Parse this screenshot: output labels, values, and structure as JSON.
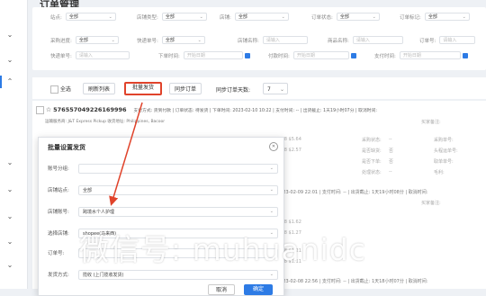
{
  "page_title": "订单管理",
  "colors": {
    "accent": "#2d7be5",
    "highlight": "#e0432b"
  },
  "filters": {
    "row1": [
      {
        "label": "站点:",
        "value": "全部"
      },
      {
        "label": "店铺类型:",
        "value": "全部"
      },
      {
        "label": "店铺:",
        "value": "全部"
      },
      {
        "label": "订单状态:",
        "value": "全部"
      },
      {
        "label": "订单标记:",
        "value": "全部"
      }
    ],
    "row2": [
      {
        "label": "采购进度:",
        "value": "全部"
      },
      {
        "label": "快递单号:",
        "value": "全部"
      },
      {
        "label": "店铺名称:",
        "placeholder": "请输入"
      },
      {
        "label": "商品名称:",
        "placeholder": "请输入"
      },
      {
        "label": "订单号:",
        "placeholder": "请输入"
      }
    ],
    "row3": [
      {
        "label": "快递单号:",
        "placeholder": "请输入"
      },
      {
        "label": "下单时间:",
        "placeholder": "开始日期"
      },
      {
        "label": "付款时间:",
        "placeholder": "开始日期"
      },
      {
        "label": "支付时间:",
        "placeholder": "开始日期"
      }
    ]
  },
  "toolbar": {
    "select_all": "全选",
    "refresh": "刷新列表",
    "batch_ship": "批量发货",
    "sync_orders": "同步订单",
    "sync_days_label": "同步订单天数:",
    "sync_days_value": "7"
  },
  "orders": [
    {
      "id": "576557049226169996",
      "meta": "支付方式: 货到付款 | 订单状态: 待发货 | 下单时间: 2023-02-10 10:22 | 支付时间: -- | 出货截止: 1天19小时07分 | 取消时间:",
      "sub": "运输服务商: J&T Express Pickup  收货地址: Philippines, Bacoor",
      "buyer_note": "买家备注:",
      "price1": "RM8 $5.64",
      "price2": "RM8 $2.57"
    },
    {
      "meta": "2023-02-09 22:01 | 支付时间: -- | 出货截止: 1天19小时08分 | 取消时间:",
      "price1": "RM8 $1.62",
      "price2": "RM8 $1.27",
      "buyer_note": "买家备注:"
    },
    {
      "meta": "2023-02-08 22:56 | 支付时间: -- | 出货截止: 1天18小时07分 | 取消时间:",
      "price1": "RM8 $1.21",
      "price2": "RM8 $1.11",
      "buyer_note": "买家备注:"
    }
  ],
  "status_cols": [
    "采购状态:",
    "是否缺货:",
    "是否下单:",
    "处理状态:"
  ],
  "status_vals": [
    "--",
    "否",
    "否",
    "--"
  ],
  "right_cols": [
    "采购单号:",
    "头程运单号:",
    "取单单号:",
    "毛利:"
  ],
  "modal": {
    "title": "批量设置发货",
    "rows": [
      {
        "label": "账号分组:",
        "value": ""
      },
      {
        "label": "店铺站点:",
        "value": "全部"
      },
      {
        "label": "店铺账号:",
        "value": "跨境水个人护理"
      },
      {
        "label": "选择店铺:",
        "value": "shopee(马来西)"
      },
      {
        "label": "订单号:",
        "value": ""
      },
      {
        "label": "发货方式:",
        "value": "揽收 (上门揽收发货)"
      }
    ],
    "cancel": "取消",
    "confirm": "确定"
  },
  "watermark": "微信号: muhuanidc"
}
